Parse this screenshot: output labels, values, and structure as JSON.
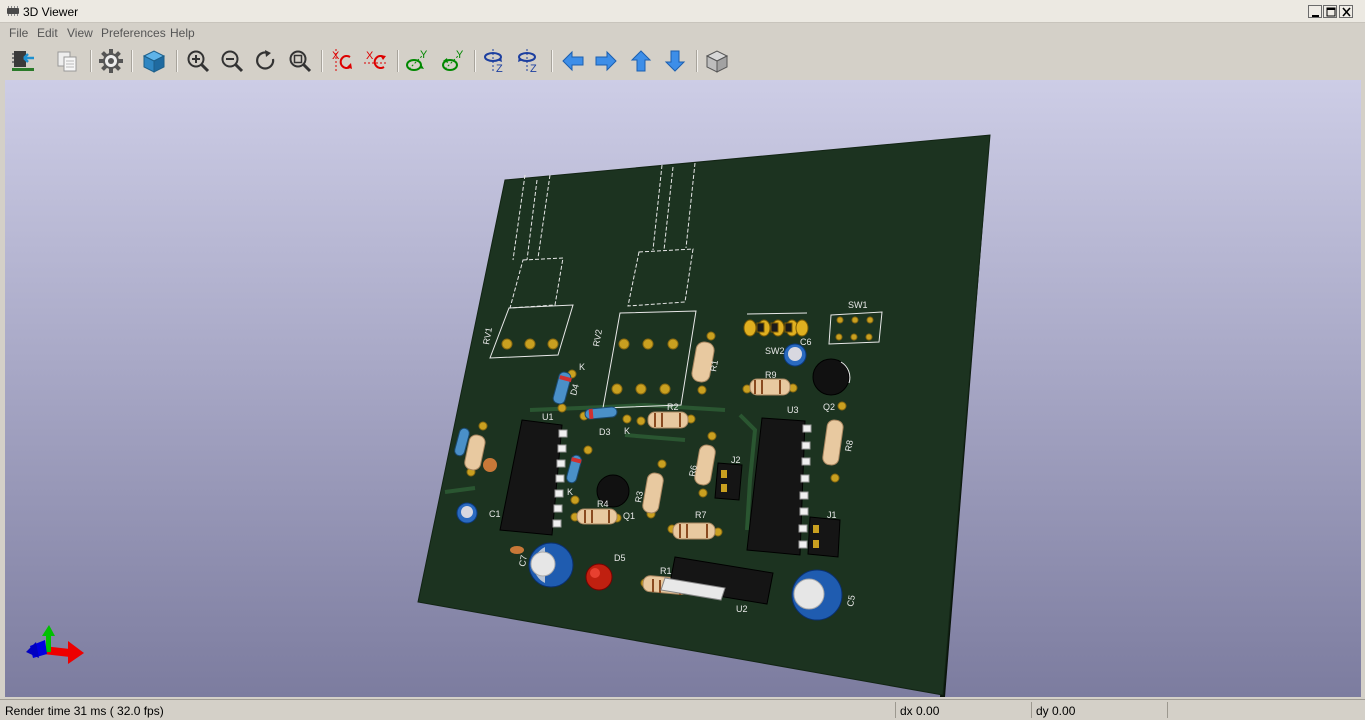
{
  "window": {
    "title": "3D Viewer",
    "controls": [
      "minimize",
      "maximize",
      "close"
    ]
  },
  "menu": [
    {
      "label": "File"
    },
    {
      "label": "Edit"
    },
    {
      "label": "View"
    },
    {
      "label": "Preferences"
    },
    {
      "label": "Help"
    }
  ],
  "toolbar": [
    {
      "icon": "reload-board-icon",
      "tooltip": "Reload board"
    },
    {
      "icon": "copy-to-clipboard-icon",
      "tooltip": "Copy 3D image to clipboard"
    },
    {
      "icon": "settings-gear-icon",
      "tooltip": "3D display options"
    },
    {
      "icon": "raytracing-cube-icon",
      "tooltip": "Render raytracing"
    },
    {
      "icon": "zoom-in-icon",
      "tooltip": "Zoom in"
    },
    {
      "icon": "zoom-out-icon",
      "tooltip": "Zoom out"
    },
    {
      "icon": "redraw-icon",
      "tooltip": "Redraw view"
    },
    {
      "icon": "zoom-fit-icon",
      "tooltip": "Fit in page"
    },
    {
      "icon": "rotate-x-cw-icon",
      "tooltip": "Rotate X clockwise"
    },
    {
      "icon": "rotate-x-ccw-icon",
      "tooltip": "Rotate X counterclockwise"
    },
    {
      "icon": "rotate-y-cw-icon",
      "tooltip": "Rotate Y clockwise"
    },
    {
      "icon": "rotate-y-ccw-icon",
      "tooltip": "Rotate Y counterclockwise"
    },
    {
      "icon": "rotate-z-cw-icon",
      "tooltip": "Rotate Z clockwise"
    },
    {
      "icon": "rotate-z-ccw-icon",
      "tooltip": "Rotate Z counterclockwise"
    },
    {
      "icon": "pan-left-icon",
      "tooltip": "Pan left"
    },
    {
      "icon": "pan-right-icon",
      "tooltip": "Pan right"
    },
    {
      "icon": "pan-up-icon",
      "tooltip": "Pan up"
    },
    {
      "icon": "pan-down-icon",
      "tooltip": "Pan down"
    },
    {
      "icon": "ortho-cube-icon",
      "tooltip": "Orthographic projection"
    }
  ],
  "board": {
    "silkscreen_labels": [
      "RV1",
      "RV2",
      "SW1",
      "SW2",
      "C6",
      "R9",
      "Q2",
      "R1",
      "D4",
      "D3",
      "R2",
      "U3",
      "R8",
      "U1",
      "R6",
      "J2",
      "R3",
      "R4",
      "Q1",
      "R7",
      "J1",
      "C7",
      "D5",
      "R1",
      "U2",
      "C5",
      "C1",
      "K",
      "K",
      "K"
    ],
    "colors": {
      "pcb": "#1c3320",
      "silkscreen": "#e8e8e8",
      "pad": "#c9a020",
      "background_top": "#cdcde6",
      "background_bottom": "#7c7c9f"
    }
  },
  "axes": {
    "x_color": "#ff0000",
    "y_color": "#00cc00",
    "z_color": "#0000ff"
  },
  "status": {
    "render": "Render time 31 ms ( 32.0 fps)",
    "dx": "dx 0.00",
    "dy": "dy 0.00"
  }
}
